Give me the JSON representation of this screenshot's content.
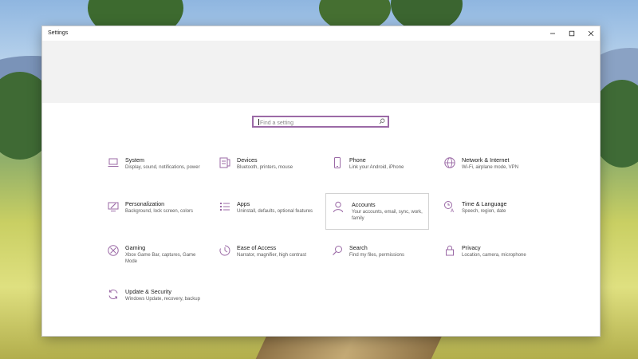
{
  "window": {
    "title": "Settings"
  },
  "search": {
    "placeholder": "Find a setting"
  },
  "accent_color": "#9b6aa6",
  "tiles": [
    {
      "id": "system",
      "title": "System",
      "desc": "Display, sound, notifications, power",
      "icon": "laptop-icon"
    },
    {
      "id": "devices",
      "title": "Devices",
      "desc": "Bluetooth, printers, mouse",
      "icon": "keyboard-speaker-icon"
    },
    {
      "id": "phone",
      "title": "Phone",
      "desc": "Link your Android, iPhone",
      "icon": "phone-icon"
    },
    {
      "id": "network",
      "title": "Network & Internet",
      "desc": "Wi-Fi, airplane mode, VPN",
      "icon": "globe-icon"
    },
    {
      "id": "personalization",
      "title": "Personalization",
      "desc": "Background, lock screen, colors",
      "icon": "paint-monitor-icon"
    },
    {
      "id": "apps",
      "title": "Apps",
      "desc": "Uninstall, defaults, optional features",
      "icon": "apps-list-icon"
    },
    {
      "id": "accounts",
      "title": "Accounts",
      "desc": "Your accounts, email, sync, work, family",
      "icon": "person-icon"
    },
    {
      "id": "time",
      "title": "Time & Language",
      "desc": "Speech, region, date",
      "icon": "time-language-icon"
    },
    {
      "id": "gaming",
      "title": "Gaming",
      "desc": "Xbox Game Bar, captures, Game Mode",
      "icon": "xbox-icon"
    },
    {
      "id": "ease",
      "title": "Ease of Access",
      "desc": "Narrator, magnifier, high contrast",
      "icon": "ease-of-access-icon"
    },
    {
      "id": "search",
      "title": "Search",
      "desc": "Find my files, permissions",
      "icon": "magnifier-icon"
    },
    {
      "id": "privacy",
      "title": "Privacy",
      "desc": "Location, camera, microphone",
      "icon": "lock-icon"
    },
    {
      "id": "update",
      "title": "Update & Security",
      "desc": "Windows Update, recovery, backup",
      "icon": "refresh-icon"
    }
  ]
}
